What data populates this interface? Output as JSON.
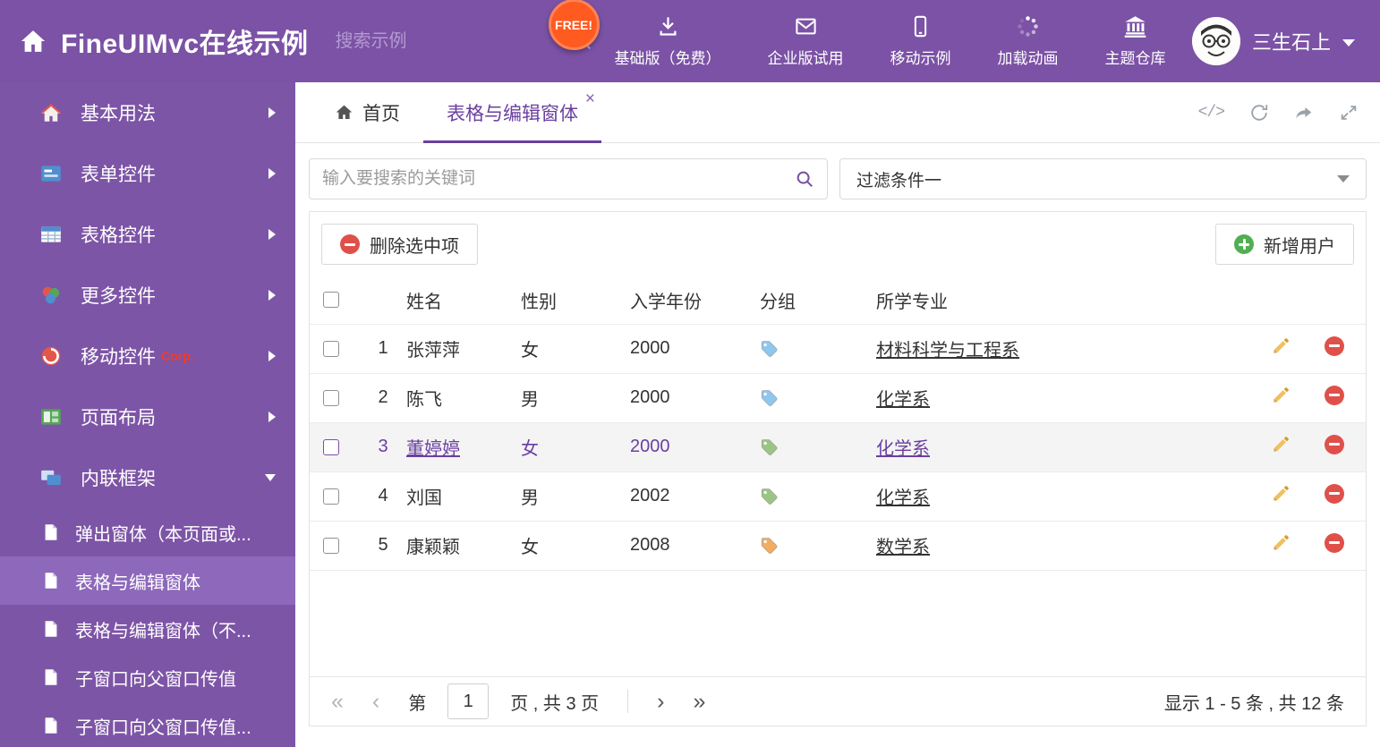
{
  "colors": {
    "header_purple": "#7b52a5",
    "sidebar_purple": "#7d55a6",
    "active_purple": "#6a3fa0",
    "free_badge_orange": "#ff5a1f",
    "danger_red": "#e0504a",
    "success_green": "#52ae52",
    "tag_blue": "#8ec7ec",
    "tag_green": "#9cc483",
    "tag_orange": "#f2ad62"
  },
  "header": {
    "title": "FineUIMvc在线示例",
    "search_placeholder": "搜索示例",
    "free_badge": "FREE!",
    "nav_items": [
      {
        "label": "基础版（免费）",
        "icon": "download-icon"
      },
      {
        "label": "企业版试用",
        "icon": "envelope-icon"
      },
      {
        "label": "移动示例",
        "icon": "mobile-icon"
      },
      {
        "label": "加载动画",
        "icon": "spinner-icon"
      },
      {
        "label": "主题仓库",
        "icon": "bank-icon"
      }
    ],
    "username": "三生石上"
  },
  "sidebar": {
    "items": [
      {
        "label": "基本用法",
        "icon": "home-icon"
      },
      {
        "label": "表单控件",
        "icon": "form-icon"
      },
      {
        "label": "表格控件",
        "icon": "table-icon"
      },
      {
        "label": "更多控件",
        "icon": "more-icon"
      },
      {
        "label": "移动控件",
        "badge": "Corp.",
        "icon": "mobile-icon"
      },
      {
        "label": "页面布局",
        "icon": "layout-icon"
      },
      {
        "label": "内联框架",
        "icon": "frame-icon",
        "expanded": true
      }
    ],
    "subitems": [
      {
        "label": "弹出窗体（本页面或..."
      },
      {
        "label": "表格与编辑窗体",
        "active": true
      },
      {
        "label": "表格与编辑窗体（不..."
      },
      {
        "label": "子窗口向父窗口传值"
      },
      {
        "label": "子窗口向父窗口传值..."
      }
    ]
  },
  "tabs": {
    "home_tab": "首页",
    "active_tab": "表格与编辑窗体",
    "close_glyph": "×",
    "code_glyph": "</>"
  },
  "filter": {
    "search_placeholder": "输入要搜索的关键词",
    "dropdown_value": "过滤条件一"
  },
  "toolbar": {
    "delete_label": "删除选中项",
    "add_label": "新增用户"
  },
  "table": {
    "columns": {
      "name": "姓名",
      "gender": "性别",
      "year": "入学年份",
      "group": "分组",
      "major": "所学专业"
    },
    "rows": [
      {
        "num": "1",
        "name": "张萍萍",
        "gender": "女",
        "year": "2000",
        "tag": "blue",
        "major": "材料科学与工程系",
        "selected": false
      },
      {
        "num": "2",
        "name": "陈飞",
        "gender": "男",
        "year": "2000",
        "tag": "blue",
        "major": "化学系",
        "selected": false
      },
      {
        "num": "3",
        "name": "董婷婷",
        "gender": "女",
        "year": "2000",
        "tag": "green",
        "major": "化学系",
        "selected": true
      },
      {
        "num": "4",
        "name": "刘国",
        "gender": "男",
        "year": "2002",
        "tag": "green",
        "major": "化学系",
        "selected": false
      },
      {
        "num": "5",
        "name": "康颖颖",
        "gender": "女",
        "year": "2008",
        "tag": "orange",
        "major": "数学系",
        "selected": false
      }
    ]
  },
  "pagination": {
    "icons": {
      "first": "«",
      "prev": "‹",
      "next": "›",
      "last": "»"
    },
    "page_prefix": "第",
    "page_value": "1",
    "page_suffix": "页 , 共 3 页",
    "summary": "显示 1 - 5 条 , 共 12 条"
  }
}
